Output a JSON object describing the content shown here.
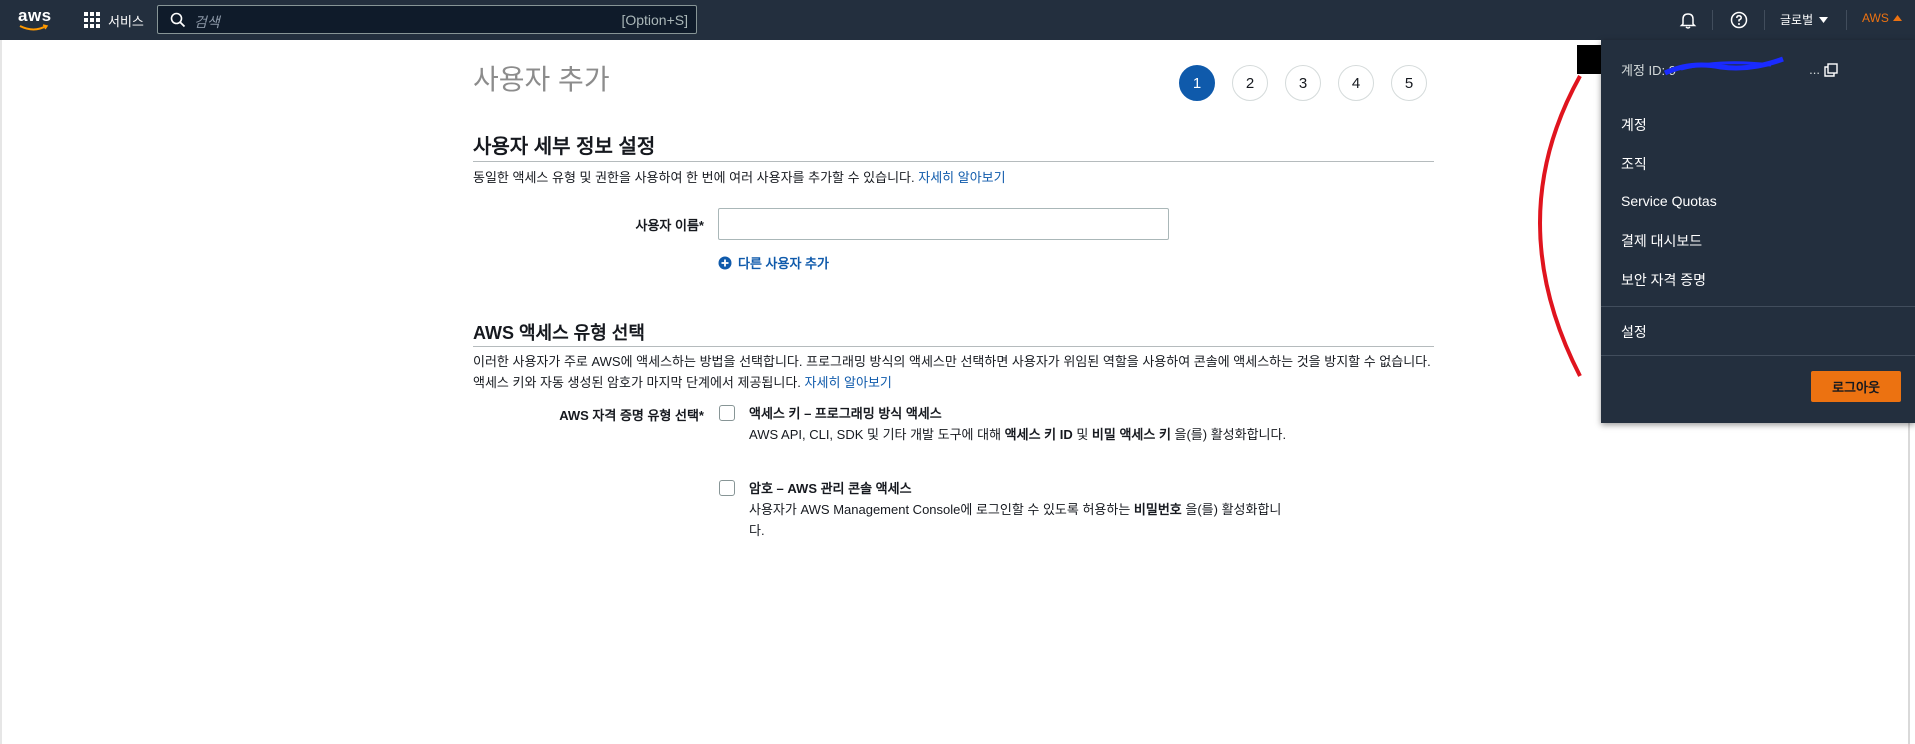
{
  "topnav": {
    "logo_text": "aws",
    "services_label": "서비스",
    "search_placeholder": "검색",
    "search_shortcut": "[Option+S]",
    "region_label": "글로벌",
    "account_label": "AWS",
    "icons": [
      "grid-icon",
      "search-icon",
      "bell-icon",
      "help-icon",
      "caret-down-icon",
      "caret-up-icon"
    ]
  },
  "main": {
    "page_title": "사용자 추가",
    "steps": [
      "1",
      "2",
      "3",
      "4",
      "5"
    ],
    "active_step": "1",
    "details_section": {
      "title": "사용자 세부 정보 설정",
      "description": "동일한 액세스 유형 및 권한을 사용하여 한 번에 여러 사용자를 추가할 수 있습니다.",
      "learn_more": "자세히 알아보기",
      "username_label": "사용자 이름*",
      "username_value": "",
      "add_user_label": "다른 사용자 추가"
    },
    "access_section": {
      "title": "AWS 액세스 유형 선택",
      "description": "이러한 사용자가 주로 AWS에 액세스하는 방법을 선택합니다. 프로그래밍 방식의 액세스만 선택하면 사용자가 위임된 역할을 사용하여 콘솔에 액세스하는 것을 방지할 수 없습니다. 액세스 키와 자동 생성된 암호가 마지막 단계에서 제공됩니다.",
      "learn_more": "자세히 알아보기",
      "credential_label": "AWS 자격 증명 유형 선택*",
      "option1": {
        "title": "액세스 키 – 프로그래밍 방식 액세스",
        "desc_pre": "AWS API, CLI, SDK 및 기타 개발 도구에 대해 ",
        "desc_b1": "액세스 키 ID",
        "desc_mid": " 및 ",
        "desc_b2": "비밀 액세스 키",
        "desc_post": " 을(를) 활성화합니다.",
        "checked": false
      },
      "option2": {
        "title": "암호 – AWS 관리 콘솔 액세스",
        "desc_pre": "사용자가 AWS Management Console에 로그인할 수 있도록 허용하는 ",
        "desc_b1": "비밀번호",
        "desc_post": " 을(를) 활성화합니다.",
        "checked": false
      }
    }
  },
  "account_menu": {
    "account_id_label": "계정 ID: 9",
    "account_id_tail": "...",
    "items": [
      "계정",
      "조직",
      "Service Quotas",
      "결제 대시보드",
      "보안 자격 증명"
    ],
    "settings": "설정",
    "logout": "로그아웃"
  },
  "colors": {
    "nav_bg": "#232f3e",
    "link": "#0f5aab",
    "accent_orange": "#ec7211",
    "annotation_red": "#e0141e"
  }
}
